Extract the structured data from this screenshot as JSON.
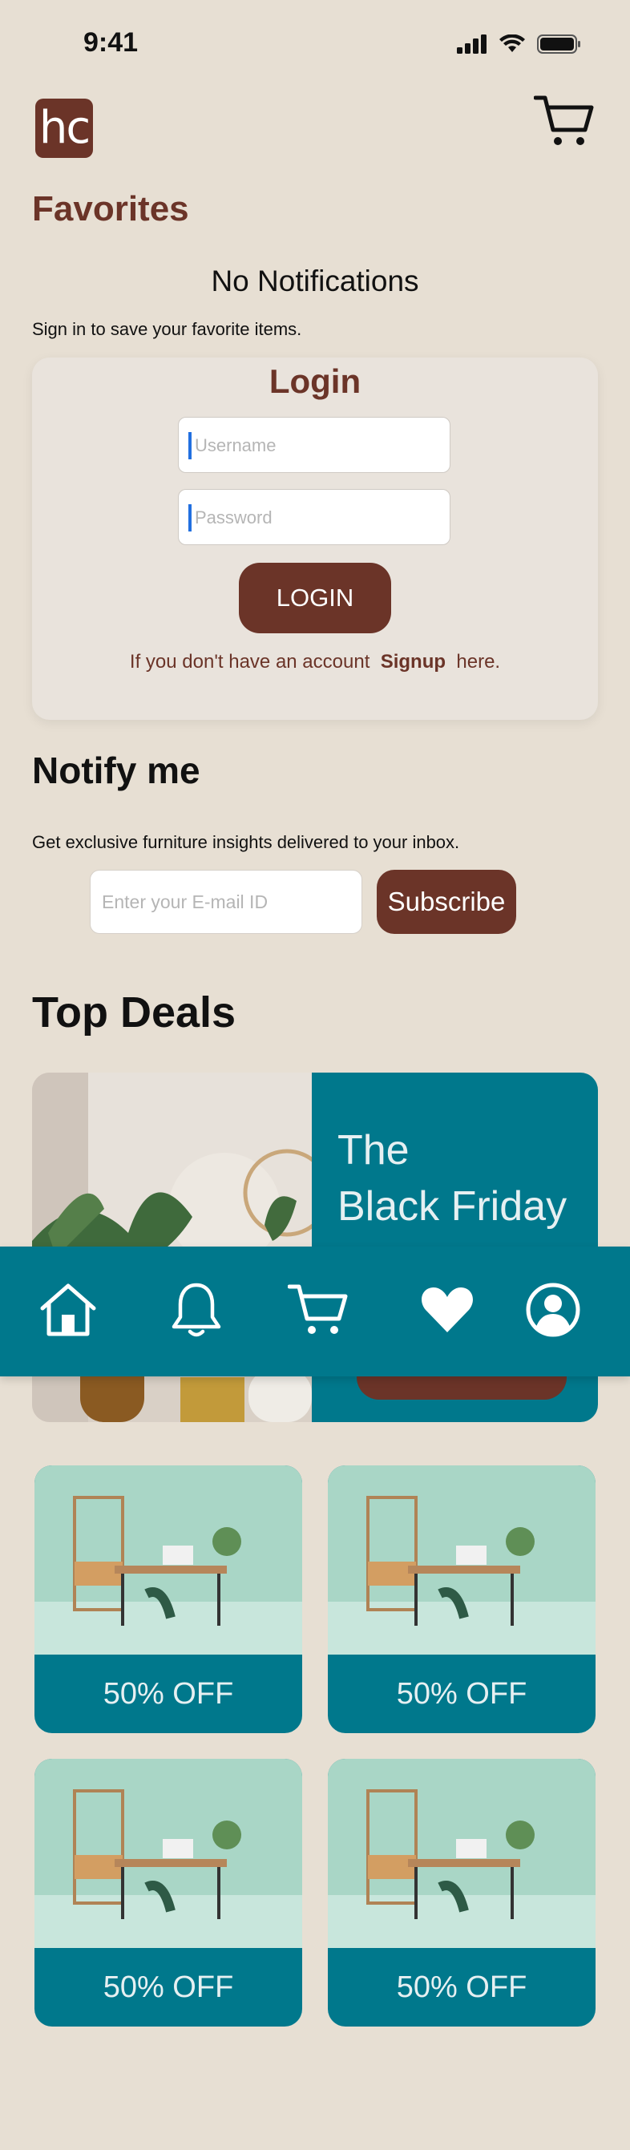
{
  "status_bar": {
    "time": "9:41"
  },
  "header": {
    "logo_text": "hc"
  },
  "favorites": {
    "title": "Favorites",
    "no_notifications": "No Notifications",
    "signin_prompt": "Sign in to save your favorite items."
  },
  "login": {
    "title": "Login",
    "username_placeholder": "Username",
    "password_placeholder": "Password",
    "button_label": "LOGIN",
    "signup_prefix": "If you don't have an account",
    "signup_link": "Signup",
    "signup_suffix": "here."
  },
  "notify": {
    "title": "Notify me",
    "subtitle": "Get exclusive furniture insights delivered to your inbox.",
    "email_placeholder": "Enter your E-mail ID",
    "subscribe_label": "Subscribe"
  },
  "deals": {
    "title": "Top Deals",
    "banner_line1": "The",
    "banner_line2": "Black Friday",
    "cards": [
      {
        "label": "50% OFF"
      },
      {
        "label": "50% OFF"
      },
      {
        "label": "50% OFF"
      },
      {
        "label": "50% OFF"
      }
    ]
  },
  "nav": {
    "items": [
      "home-icon",
      "bell-icon",
      "cart-icon",
      "heart-icon",
      "profile-icon"
    ]
  },
  "colors": {
    "background": "#e7dfd3",
    "brand_brown": "#6b3428",
    "teal": "#00788c"
  }
}
